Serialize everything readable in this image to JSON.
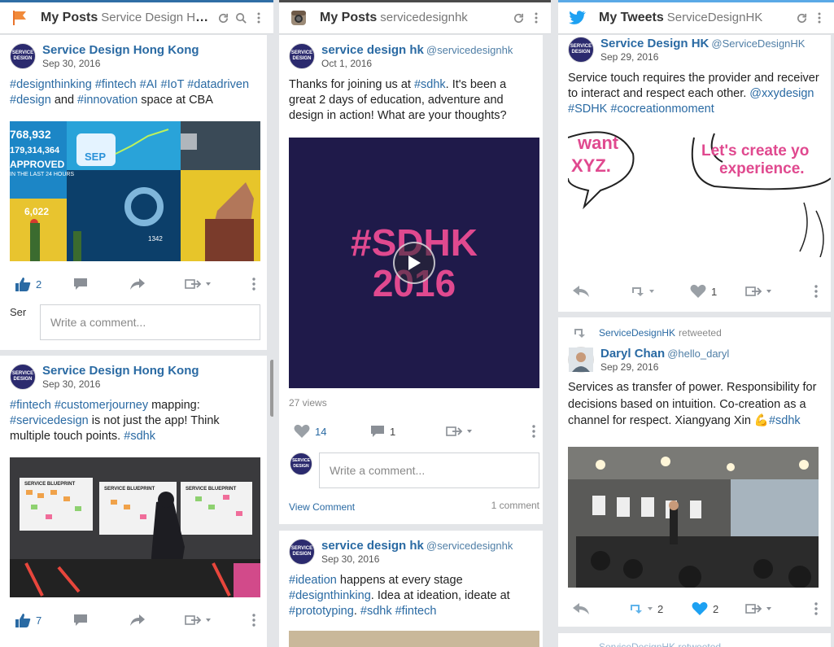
{
  "columns": [
    {
      "title": "My Posts",
      "subtitle": "Service Design Hon…",
      "network_icon": "flag-icon",
      "posts": [
        {
          "author": "Service Design Hong Kong",
          "date": "Sep 30, 2016",
          "text_parts": [
            {
              "t": "#designthinking",
              "tag": true
            },
            {
              "t": " "
            },
            {
              "t": "#fintech",
              "tag": true
            },
            {
              "t": " "
            },
            {
              "t": "#AI",
              "tag": true
            },
            {
              "t": " "
            },
            {
              "t": "#IoT",
              "tag": true
            },
            {
              "t": " "
            },
            {
              "t": "#datadriven",
              "tag": true
            },
            {
              "t": " "
            },
            {
              "t": "#design",
              "tag": true
            },
            {
              "t": " and "
            },
            {
              "t": "#innovation",
              "tag": true
            },
            {
              "t": " space at CBA"
            }
          ],
          "image_text": {
            "big1": "768,932",
            "big2": "179,314,364",
            "approved": "APPROVED",
            "sub": "IN THE LAST 24 HOURS",
            "sep": "SEP",
            "num": "6,022",
            "num2": "1342"
          },
          "likes": "2",
          "comment_placeholder": "Write a comment...",
          "avatar_label": "Ser"
        },
        {
          "author": "Service Design Hong Kong",
          "date": "Sep 30, 2016",
          "text_parts": [
            {
              "t": "#fintech",
              "tag": true
            },
            {
              "t": " "
            },
            {
              "t": "#customerjourney",
              "tag": true
            },
            {
              "t": " mapping: "
            },
            {
              "t": "#servicedesign",
              "tag": true
            },
            {
              "t": " is not just the app! Think multiple touch points. "
            },
            {
              "t": "#sdhk",
              "tag": true
            }
          ],
          "image_text": {
            "bp1": "SERVICE BLUEPRINT",
            "bp2": "SERVICE BLUEPRINT",
            "bp3": "SERVICE BLUEPRINT"
          },
          "likes": "7"
        }
      ]
    },
    {
      "title": "My Posts",
      "subtitle": "servicedesignhk",
      "network_icon": "camera-icon",
      "posts": [
        {
          "author": "service design hk",
          "handle": "@servicedesignhk",
          "date": "Oct 1, 2016",
          "text_parts": [
            {
              "t": "Thanks for joining us at "
            },
            {
              "t": "#sdhk",
              "tag": true
            },
            {
              "t": ". It's been a great 2 days of education, adventure and design in action! What are your thoughts?"
            }
          ],
          "video_text": "#SDHK",
          "video_year": "2016",
          "views": "27 views",
          "likes": "14",
          "comments": "1",
          "comment_placeholder": "Write a comment...",
          "view_comment": "View Comment",
          "comment_count_label": "1 comment"
        },
        {
          "author": "service design hk",
          "handle": "@servicedesignhk",
          "date": "Sep 30, 2016",
          "text_parts": [
            {
              "t": "#ideation",
              "tag": true
            },
            {
              "t": " happens at every stage "
            },
            {
              "t": "#designthinking",
              "tag": true
            },
            {
              "t": ". Idea at ideation, ideate at "
            },
            {
              "t": "#prototyping",
              "tag": true
            },
            {
              "t": ". "
            },
            {
              "t": "#sdhk",
              "tag": true
            },
            {
              "t": " "
            },
            {
              "t": "#fintech",
              "tag": true
            }
          ]
        }
      ]
    },
    {
      "title": "My Tweets",
      "subtitle": "ServiceDesignHK",
      "network_icon": "bird-icon",
      "posts": [
        {
          "author": "Service Design HK",
          "handle": "@ServiceDesignHK",
          "date": "Sep 29, 2016",
          "text_parts": [
            {
              "t": "Service touch requires the provider and receiver to interact and respect each other. "
            },
            {
              "t": "@xxydesign",
              "tag": true
            },
            {
              "t": " "
            },
            {
              "t": "#SDHK",
              "tag": true
            },
            {
              "t": " "
            },
            {
              "t": "#cocreationmoment",
              "tag": true
            }
          ],
          "bubble_left_1": "want",
          "bubble_left_2": "XYZ.",
          "bubble_right_1": "Let's create yo",
          "bubble_right_2": "experience.",
          "likes": "1"
        },
        {
          "retweeted_by": "ServiceDesignHK",
          "retweeted_label": "retweeted",
          "author": "Daryl Chan",
          "handle": "@hello_daryl",
          "date": "Sep 29, 2016",
          "text_parts": [
            {
              "t": "Services as transfer of power. Responsibility for decisions based on intuition. Co-creation as a channel for respect. Xiangyang Xin 💪"
            },
            {
              "t": "#sdhk",
              "tag": true
            }
          ],
          "retweets": "2",
          "likes": "2"
        }
      ],
      "next_retweet_label": "ServiceDesignHK retweeted"
    }
  ],
  "avatar_brand": "SERVICE DESIGN",
  "colors": {
    "accent": "#2a6aa3",
    "twitter": "#1da1f2",
    "video_bg": "#1f1a4a",
    "video_text": "#e0498f"
  }
}
